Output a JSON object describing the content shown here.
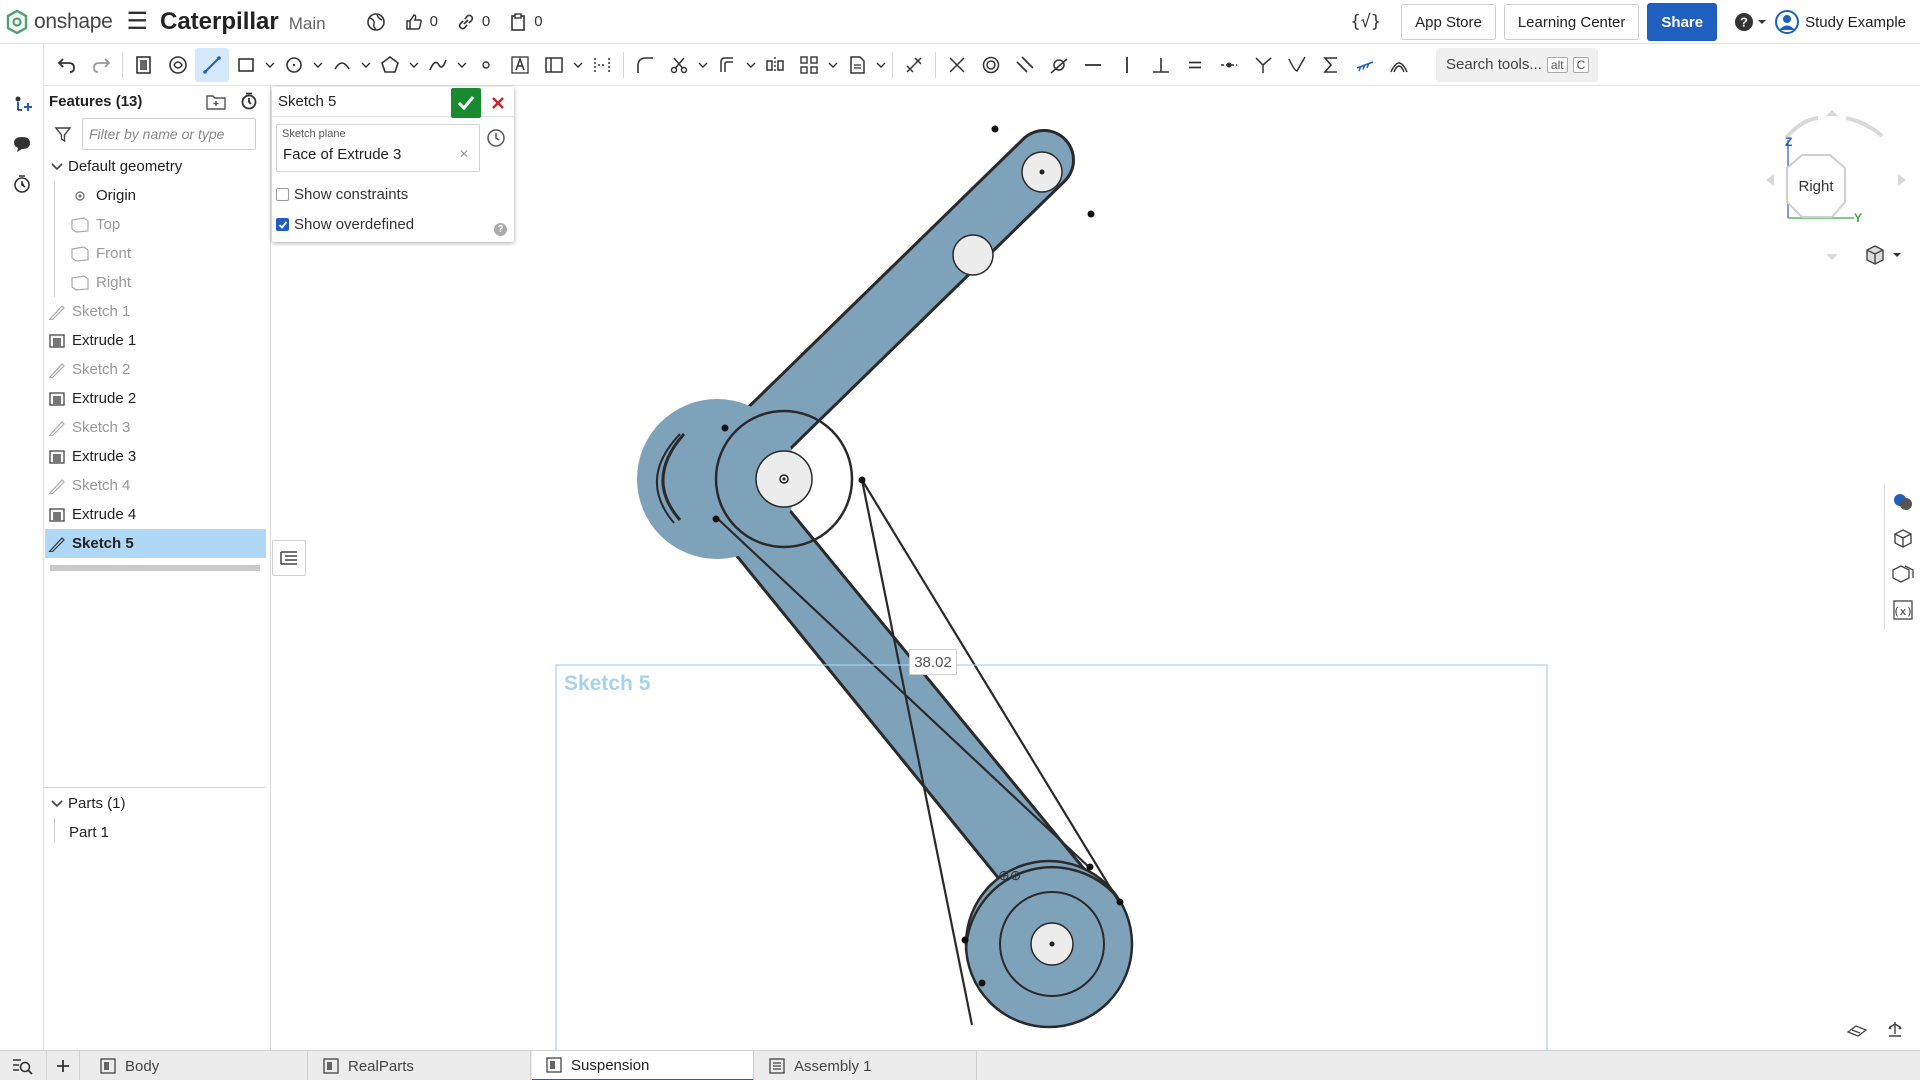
{
  "header": {
    "brand": "onshape",
    "document_title": "Caterpillar",
    "branch": "Main",
    "likes": "0",
    "links": "0",
    "copies": "0",
    "variables_glyph": "{√}",
    "app_store": "App Store",
    "learning_center": "Learning Center",
    "share": "Share",
    "user_name": "Study Example"
  },
  "toolbar": {
    "search_placeholder": "Search tools...",
    "search_shortcut_mod": "alt",
    "search_shortcut_key": "C"
  },
  "feature_panel": {
    "title": "Features (13)",
    "filter_placeholder": "Filter by name or type",
    "default_geometry": "Default geometry",
    "origin": "Origin",
    "planes": [
      "Top",
      "Front",
      "Right"
    ],
    "features": [
      {
        "label": "Sketch 1",
        "kind": "sketch"
      },
      {
        "label": "Extrude 1",
        "kind": "extrude"
      },
      {
        "label": "Sketch 2",
        "kind": "sketch"
      },
      {
        "label": "Extrude 2",
        "kind": "extrude"
      },
      {
        "label": "Sketch 3",
        "kind": "sketch"
      },
      {
        "label": "Extrude 3",
        "kind": "extrude"
      },
      {
        "label": "Sketch 4",
        "kind": "sketch"
      },
      {
        "label": "Extrude 4",
        "kind": "extrude"
      },
      {
        "label": "Sketch 5",
        "kind": "sketch",
        "selected": true
      }
    ],
    "parts_header": "Parts (1)",
    "parts": [
      "Part 1"
    ]
  },
  "sketch_dialog": {
    "title": "Sketch 5",
    "plane_label": "Sketch plane",
    "plane_value": "Face of Extrude 3",
    "show_constraints": "Show constraints",
    "show_constraints_checked": false,
    "show_overdefined": "Show overdefined",
    "show_overdefined_checked": true
  },
  "viewport": {
    "sketch_label": "Sketch 5",
    "dimension_value": "38.02",
    "view_cube_face": "Right",
    "axis_z": "Z",
    "axis_y": "Y",
    "part_color": "#7fa2bb",
    "sketch_box_color": "#a6d2ef"
  },
  "tabs": [
    {
      "label": "Body",
      "active": false
    },
    {
      "label": "RealParts",
      "active": false
    },
    {
      "label": "Suspension",
      "active": true
    },
    {
      "label": "Assembly 1",
      "active": false
    }
  ],
  "colors": {
    "accent": "#1f5fbf",
    "confirm": "#1a8a30",
    "cancel": "#d3202a",
    "selection": "#aed8f5"
  }
}
